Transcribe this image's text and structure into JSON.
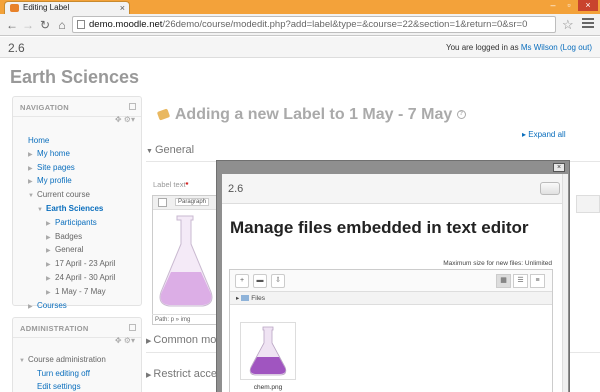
{
  "browser": {
    "tab_title": "Editing Label",
    "tab_close": "×",
    "url_host": "demo.moodle.net",
    "url_path": "/26demo/course/modedit.php?add=label&type=&course=22&section=1&return=0&sr=0",
    "icons": [
      "back-icon",
      "forward-icon",
      "reload-icon",
      "home-icon",
      "star-icon",
      "menu-icon"
    ]
  },
  "header": {
    "brand": "2.6",
    "login_prefix": "You are logged in as ",
    "user": "Ms Wilson",
    "logout": "(Log out)"
  },
  "course_title": "Earth Sciences",
  "navigation": {
    "heading": "NAVIGATION",
    "items": [
      {
        "label": "Home",
        "level": 0,
        "caret": ""
      },
      {
        "label": "My home",
        "level": 1,
        "caret": "▶"
      },
      {
        "label": "Site pages",
        "level": 1,
        "caret": "▶"
      },
      {
        "label": "My profile",
        "level": 1,
        "caret": "▶"
      },
      {
        "label": "Current course",
        "level": 1,
        "caret": "▼"
      },
      {
        "label": "Earth Sciences",
        "level": 2,
        "caret": "▼"
      },
      {
        "label": "Participants",
        "level": 3,
        "caret": "▶"
      },
      {
        "label": "Badges",
        "level": 3,
        "caret": "▶"
      },
      {
        "label": "General",
        "level": 3,
        "caret": "▶"
      },
      {
        "label": "17 April - 23 April",
        "level": 3,
        "caret": "▶"
      },
      {
        "label": "24 April - 30 April",
        "level": 3,
        "caret": "▶"
      },
      {
        "label": "1 May - 7 May",
        "level": 3,
        "caret": "▶"
      },
      {
        "label": "Courses",
        "level": 1,
        "caret": "▶"
      }
    ]
  },
  "administration": {
    "heading": "ADMINISTRATION",
    "items": [
      {
        "label": "Course administration",
        "caret": "▼"
      },
      {
        "label": "Turn editing off",
        "caret": ""
      },
      {
        "label": "Edit settings",
        "caret": ""
      }
    ]
  },
  "main": {
    "heading": "Adding a new Label to 1 May - 7 May",
    "help": "?",
    "expand_all": "Expand all",
    "sections": [
      "General",
      "Common mo",
      "Restrict acce"
    ],
    "label_text": "Label text",
    "required_mark": "*",
    "editor_format": "Paragraph",
    "editor_path": "Path: p » img"
  },
  "modal": {
    "close": "×",
    "brand": "2.6",
    "title": "Manage files embedded in text editor",
    "max_size": "Maximum size for new files: Unlimited",
    "path_label": "Files",
    "files": [
      {
        "name": "chem.png"
      }
    ]
  }
}
